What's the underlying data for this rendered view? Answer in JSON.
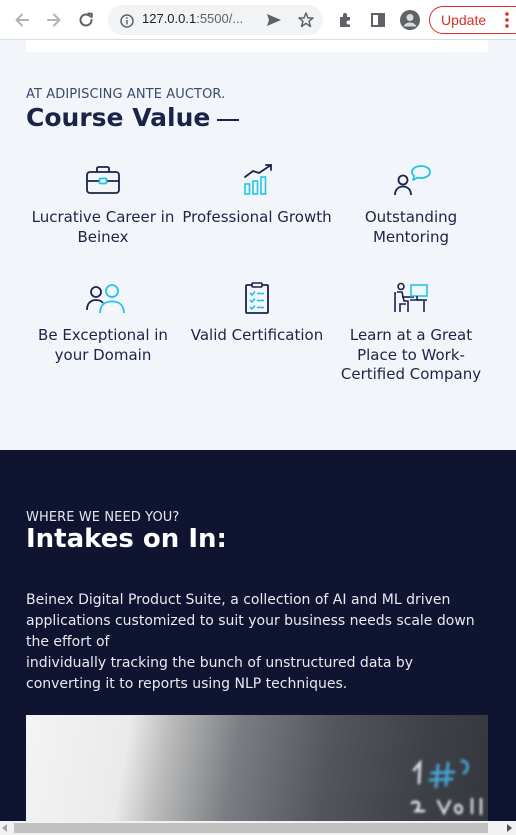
{
  "browser": {
    "url_host": "127.0.0.1",
    "url_rest": ":5500/...",
    "update_label": "Update",
    "icons": [
      "back-icon",
      "forward-icon",
      "reload-icon",
      "info-icon",
      "share-icon",
      "star-icon",
      "extensions-icon",
      "sidepanel-icon",
      "profile-icon",
      "more-icon"
    ]
  },
  "course": {
    "eyebrow": "AT ADIPISCING ANTE AUCTOR.",
    "title": "Course Value",
    "items": [
      {
        "label": "Lucrative Career in Beinex",
        "icon": "briefcase-icon"
      },
      {
        "label": "Professional Growth",
        "icon": "growth-chart-icon"
      },
      {
        "label": "Outstanding Mentoring",
        "icon": "mentoring-icon"
      },
      {
        "label": "Be Exceptional in your Domain",
        "icon": "people-icon"
      },
      {
        "label": "Valid Certification",
        "icon": "clipboard-check-icon"
      },
      {
        "label": "Learn at a Great Place to Work-Certified Company",
        "icon": "workstation-icon"
      }
    ]
  },
  "intakes": {
    "eyebrow": "WHERE WE NEED YOU?",
    "title": "Intakes on In:",
    "desc_p1": "Beinex Digital Product Suite, a collection of AI and ML driven applications customized to suit your business needs scale down the effort of",
    "desc_p2": "individually tracking the bunch of unstructured data by converting it to reports using NLP techniques."
  },
  "colors": {
    "navy": "#1a2447",
    "accent_cyan": "#1fc6e6",
    "light_bg": "#f2f5fa",
    "dark_bg": "#0f1530",
    "update_red": "#d93025"
  }
}
